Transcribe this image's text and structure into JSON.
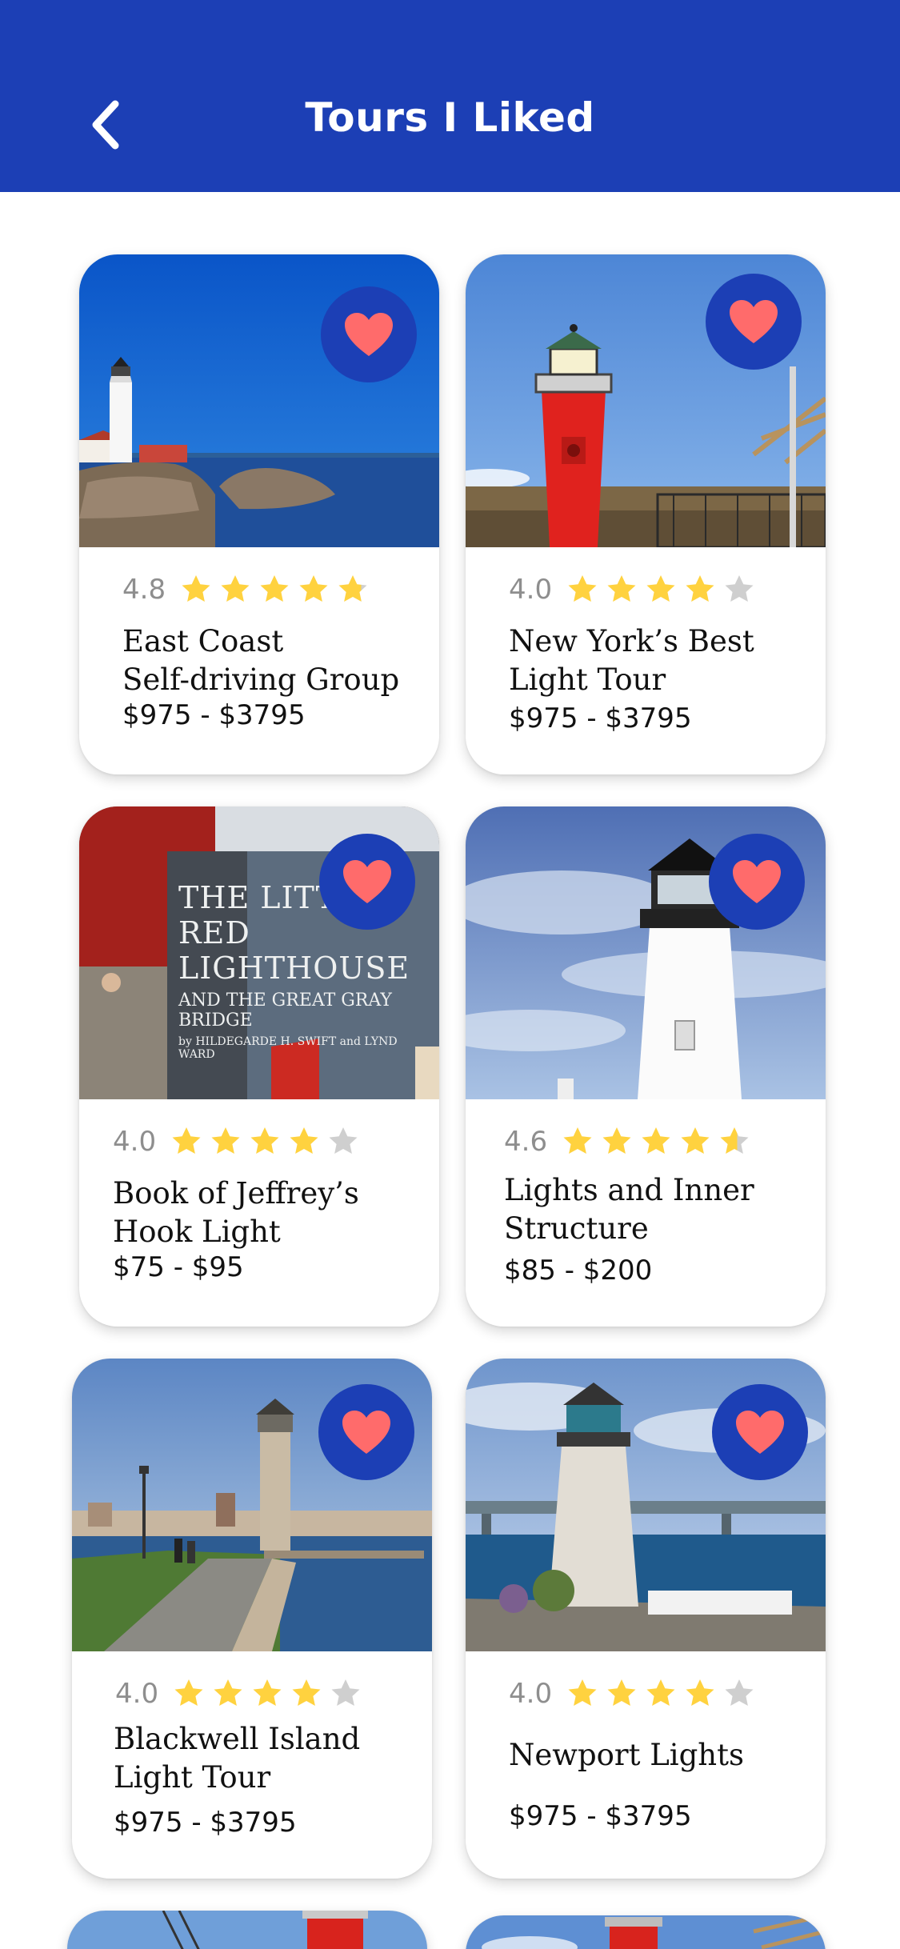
{
  "header": {
    "title": "Tours I Liked",
    "back_icon": "chevron-left-icon",
    "background": "#1c3fb5"
  },
  "colors": {
    "accent": "#1c3fb5",
    "heart": "#ff6b6b",
    "star_filled": "#ffd23f",
    "star_empty": "#cfcfcf"
  },
  "tours": [
    {
      "rating": "4.8",
      "stars": 4.8,
      "title_line1": "East Coast",
      "title_line2": "Self-driving Group",
      "price": "$975 - $3795",
      "liked": true
    },
    {
      "rating": "4.0",
      "stars": 4.0,
      "title_line1": "New York’s Best",
      "title_line2": "Light Tour",
      "price": "$975 - $3795",
      "liked": true
    },
    {
      "rating": "4.0",
      "stars": 4.0,
      "title_line1": "Book of Jeffrey’s",
      "title_line2": "Hook Light",
      "price": "$75 - $95",
      "liked": true
    },
    {
      "rating": "4.6",
      "stars": 4.6,
      "title_line1": "Lights and Inner",
      "title_line2": "Structure",
      "price": "$85 - $200",
      "liked": true
    },
    {
      "rating": "4.0",
      "stars": 4.0,
      "title_line1": "Blackwell Island",
      "title_line2": "Light Tour",
      "price": "$975 - $3795",
      "liked": true
    },
    {
      "rating": "4.0",
      "stars": 4.0,
      "title_line1": "Newport Lights",
      "title_line2": "",
      "price": "$975 - $3795",
      "liked": true
    }
  ],
  "book_cover": {
    "title": "THE LITTLE RED LIGHTHOUSE",
    "subtitle": "AND THE GREAT GRAY BRIDGE",
    "authors": "by HILDEGARDE H. SWIFT and LYND WARD"
  }
}
